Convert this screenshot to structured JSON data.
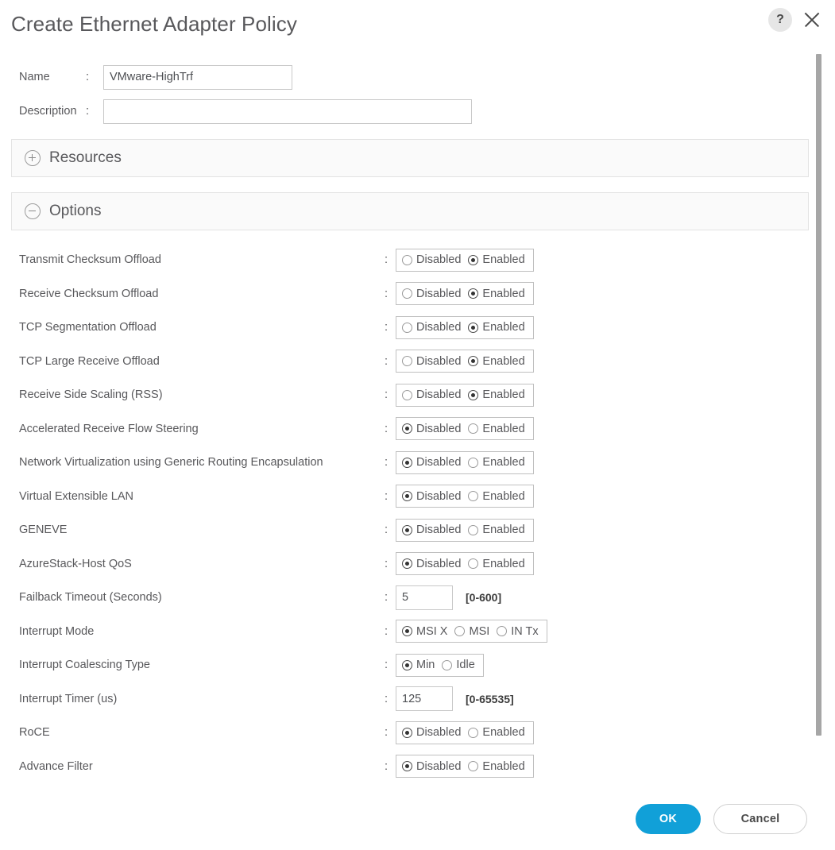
{
  "header": {
    "title": "Create Ethernet Adapter Policy",
    "help_icon": "help-question-icon",
    "help_label": "?",
    "close_icon": "close-icon"
  },
  "fields": {
    "name": {
      "label": "Name",
      "colon": ":",
      "value": "VMware-HighTrf",
      "placeholder": ""
    },
    "description": {
      "label": "Description",
      "colon": ":",
      "value": "",
      "placeholder": ""
    }
  },
  "sections": [
    {
      "title": "Resources",
      "expanded": false,
      "icon": "plus-circle-icon"
    },
    {
      "title": "Options",
      "expanded": true,
      "icon": "minus-circle-icon"
    }
  ],
  "options": [
    {
      "label": "Transmit Checksum Offload",
      "colon": ":",
      "type": "radio",
      "choices": [
        {
          "label": "Disabled",
          "selected": false
        },
        {
          "label": "Enabled",
          "selected": true
        }
      ]
    },
    {
      "label": "Receive Checksum Offload",
      "colon": ":",
      "type": "radio",
      "choices": [
        {
          "label": "Disabled",
          "selected": false
        },
        {
          "label": "Enabled",
          "selected": true
        }
      ]
    },
    {
      "label": "TCP Segmentation Offload",
      "colon": ":",
      "type": "radio",
      "choices": [
        {
          "label": "Disabled",
          "selected": false
        },
        {
          "label": "Enabled",
          "selected": true
        }
      ]
    },
    {
      "label": "TCP Large Receive Offload",
      "colon": ":",
      "type": "radio",
      "choices": [
        {
          "label": "Disabled",
          "selected": false
        },
        {
          "label": "Enabled",
          "selected": true
        }
      ]
    },
    {
      "label": "Receive Side Scaling (RSS)",
      "colon": ":",
      "type": "radio",
      "choices": [
        {
          "label": "Disabled",
          "selected": false
        },
        {
          "label": "Enabled",
          "selected": true
        }
      ]
    },
    {
      "label": "Accelerated Receive Flow Steering",
      "colon": ":",
      "type": "radio",
      "choices": [
        {
          "label": "Disabled",
          "selected": true
        },
        {
          "label": "Enabled",
          "selected": false
        }
      ]
    },
    {
      "label": "Network Virtualization using Generic Routing Encapsulation",
      "colon": ":",
      "type": "radio",
      "choices": [
        {
          "label": "Disabled",
          "selected": true
        },
        {
          "label": "Enabled",
          "selected": false
        }
      ]
    },
    {
      "label": "Virtual Extensible LAN",
      "colon": ":",
      "type": "radio",
      "choices": [
        {
          "label": "Disabled",
          "selected": true
        },
        {
          "label": "Enabled",
          "selected": false
        }
      ]
    },
    {
      "label": "GENEVE",
      "colon": ":",
      "type": "radio",
      "choices": [
        {
          "label": "Disabled",
          "selected": true
        },
        {
          "label": "Enabled",
          "selected": false
        }
      ]
    },
    {
      "label": "AzureStack-Host QoS",
      "colon": ":",
      "type": "radio",
      "choices": [
        {
          "label": "Disabled",
          "selected": true
        },
        {
          "label": "Enabled",
          "selected": false
        }
      ]
    },
    {
      "label": "Failback Timeout (Seconds)",
      "colon": ":",
      "type": "number",
      "value": "5",
      "hint": "[0-600]"
    },
    {
      "label": "Interrupt Mode",
      "colon": ":",
      "type": "radio",
      "choices": [
        {
          "label": "MSI X",
          "selected": true
        },
        {
          "label": "MSI",
          "selected": false
        },
        {
          "label": "IN Tx",
          "selected": false
        }
      ]
    },
    {
      "label": "Interrupt Coalescing Type",
      "colon": ":",
      "type": "radio",
      "choices": [
        {
          "label": "Min",
          "selected": true
        },
        {
          "label": "Idle",
          "selected": false
        }
      ]
    },
    {
      "label": "Interrupt Timer (us)",
      "colon": ":",
      "type": "number",
      "value": "125",
      "hint": "[0-65535]"
    },
    {
      "label": "RoCE",
      "colon": ":",
      "type": "radio",
      "choices": [
        {
          "label": "Disabled",
          "selected": true
        },
        {
          "label": "Enabled",
          "selected": false
        }
      ]
    },
    {
      "label": "Advance Filter",
      "colon": ":",
      "type": "radio",
      "choices": [
        {
          "label": "Disabled",
          "selected": true
        },
        {
          "label": "Enabled",
          "selected": false
        }
      ]
    }
  ],
  "footer": {
    "ok_label": "OK",
    "cancel_label": "Cancel"
  },
  "colors": {
    "accent": "#11a0d8",
    "text": "#58585b",
    "section_bg": "#fafafa",
    "border": "#c0c0c0",
    "scrollbar": "#a6a6a6"
  }
}
